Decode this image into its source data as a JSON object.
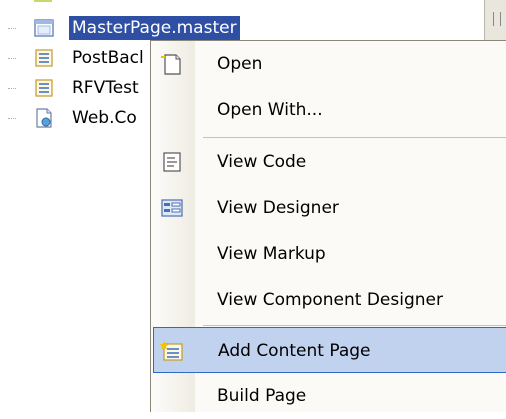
{
  "tree": {
    "items": [
      {
        "label": "MasterPage.master",
        "icon": "master-page-icon",
        "selected": true
      },
      {
        "label": "PostBacl",
        "icon": "web-form-icon"
      },
      {
        "label": "RFVTest",
        "icon": "web-form-icon"
      },
      {
        "label": "Web.Co",
        "icon": "config-file-icon"
      }
    ]
  },
  "menu": {
    "items": [
      {
        "label": "Open",
        "icon": "open-document-icon"
      },
      {
        "label": "Open With...",
        "icon": ""
      },
      {
        "label": "View Code",
        "icon": "view-code-icon"
      },
      {
        "label": "View Designer",
        "icon": "view-designer-icon"
      },
      {
        "label": "View Markup",
        "icon": ""
      },
      {
        "label": "View Component Designer",
        "icon": ""
      },
      {
        "label": "Add Content Page",
        "icon": "add-content-page-icon",
        "highlighted": true
      },
      {
        "label": "Build Page",
        "icon": ""
      }
    ]
  },
  "colors": {
    "selection": "#2f4fa5",
    "menu_highlight": "#c1d2ee",
    "menu_highlight_border": "#316ac5"
  }
}
